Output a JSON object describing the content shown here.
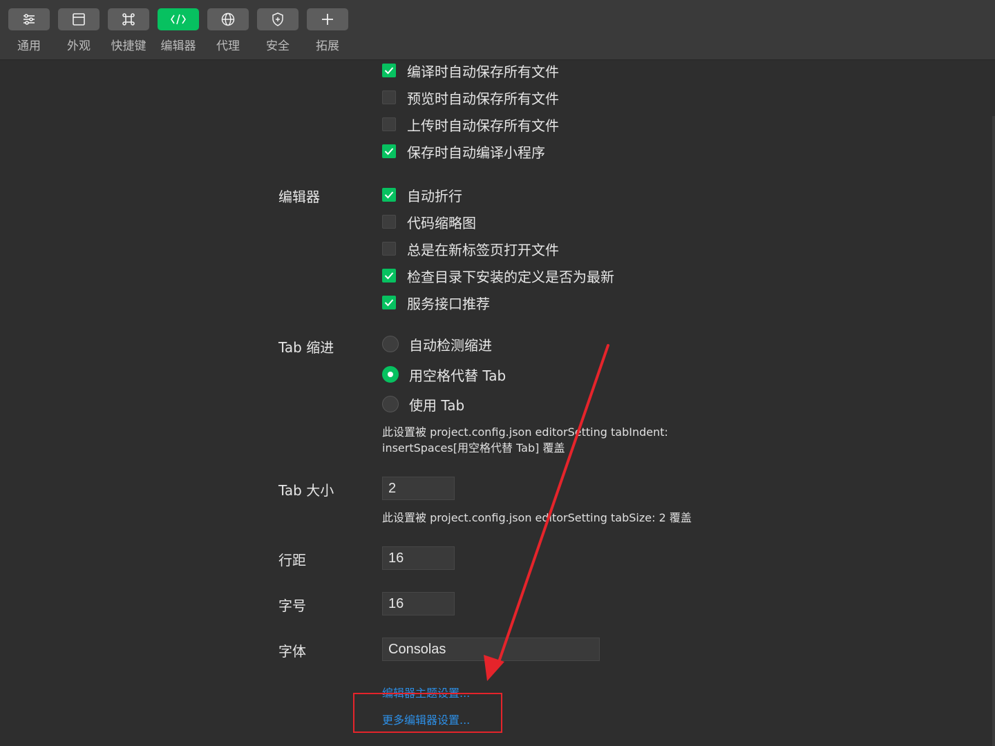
{
  "toolbar": {
    "tabs": [
      {
        "label": "通用",
        "icon": "sliders-icon",
        "active": false
      },
      {
        "label": "外观",
        "icon": "window-icon",
        "active": false
      },
      {
        "label": "快捷键",
        "icon": "command-key-icon",
        "active": false
      },
      {
        "label": "编辑器",
        "icon": "code-icon",
        "active": true
      },
      {
        "label": "代理",
        "icon": "globe-icon",
        "active": false
      },
      {
        "label": "安全",
        "icon": "shield-icon",
        "active": false
      },
      {
        "label": "拓展",
        "icon": "plus-icon",
        "active": false
      }
    ]
  },
  "save_options": [
    {
      "label": "编译时自动保存所有文件",
      "checked": true
    },
    {
      "label": "预览时自动保存所有文件",
      "checked": false
    },
    {
      "label": "上传时自动保存所有文件",
      "checked": false
    },
    {
      "label": "保存时自动编译小程序",
      "checked": true
    }
  ],
  "editor": {
    "label": "编辑器",
    "options": [
      {
        "label": "自动折行",
        "checked": true
      },
      {
        "label": "代码缩略图",
        "checked": false
      },
      {
        "label": "总是在新标签页打开文件",
        "checked": false
      },
      {
        "label": "检查目录下安装的定义是否为最新",
        "checked": true
      },
      {
        "label": "服务接口推荐",
        "checked": true
      }
    ]
  },
  "tab_indent": {
    "label": "Tab 缩进",
    "options": [
      {
        "label": "自动检测缩进",
        "selected": false
      },
      {
        "label": "用空格代替 Tab",
        "selected": true
      },
      {
        "label": "使用 Tab",
        "selected": false
      }
    ],
    "note_line1": "此设置被 project.config.json editorSetting tabIndent:",
    "note_line2": "insertSpaces[用空格代替 Tab] 覆盖"
  },
  "tab_size": {
    "label": "Tab 大小",
    "value": "2",
    "note": "此设置被 project.config.json editorSetting tabSize: 2 覆盖"
  },
  "line_height": {
    "label": "行距",
    "value": "16"
  },
  "font_size": {
    "label": "字号",
    "value": "16"
  },
  "font_family": {
    "label": "字体",
    "value": "Consolas"
  },
  "links": {
    "theme": "编辑器主题设置...",
    "more": "更多编辑器设置..."
  },
  "colors": {
    "accent": "#07c160",
    "link": "#2d8fe6",
    "annotation": "#e5242b"
  }
}
